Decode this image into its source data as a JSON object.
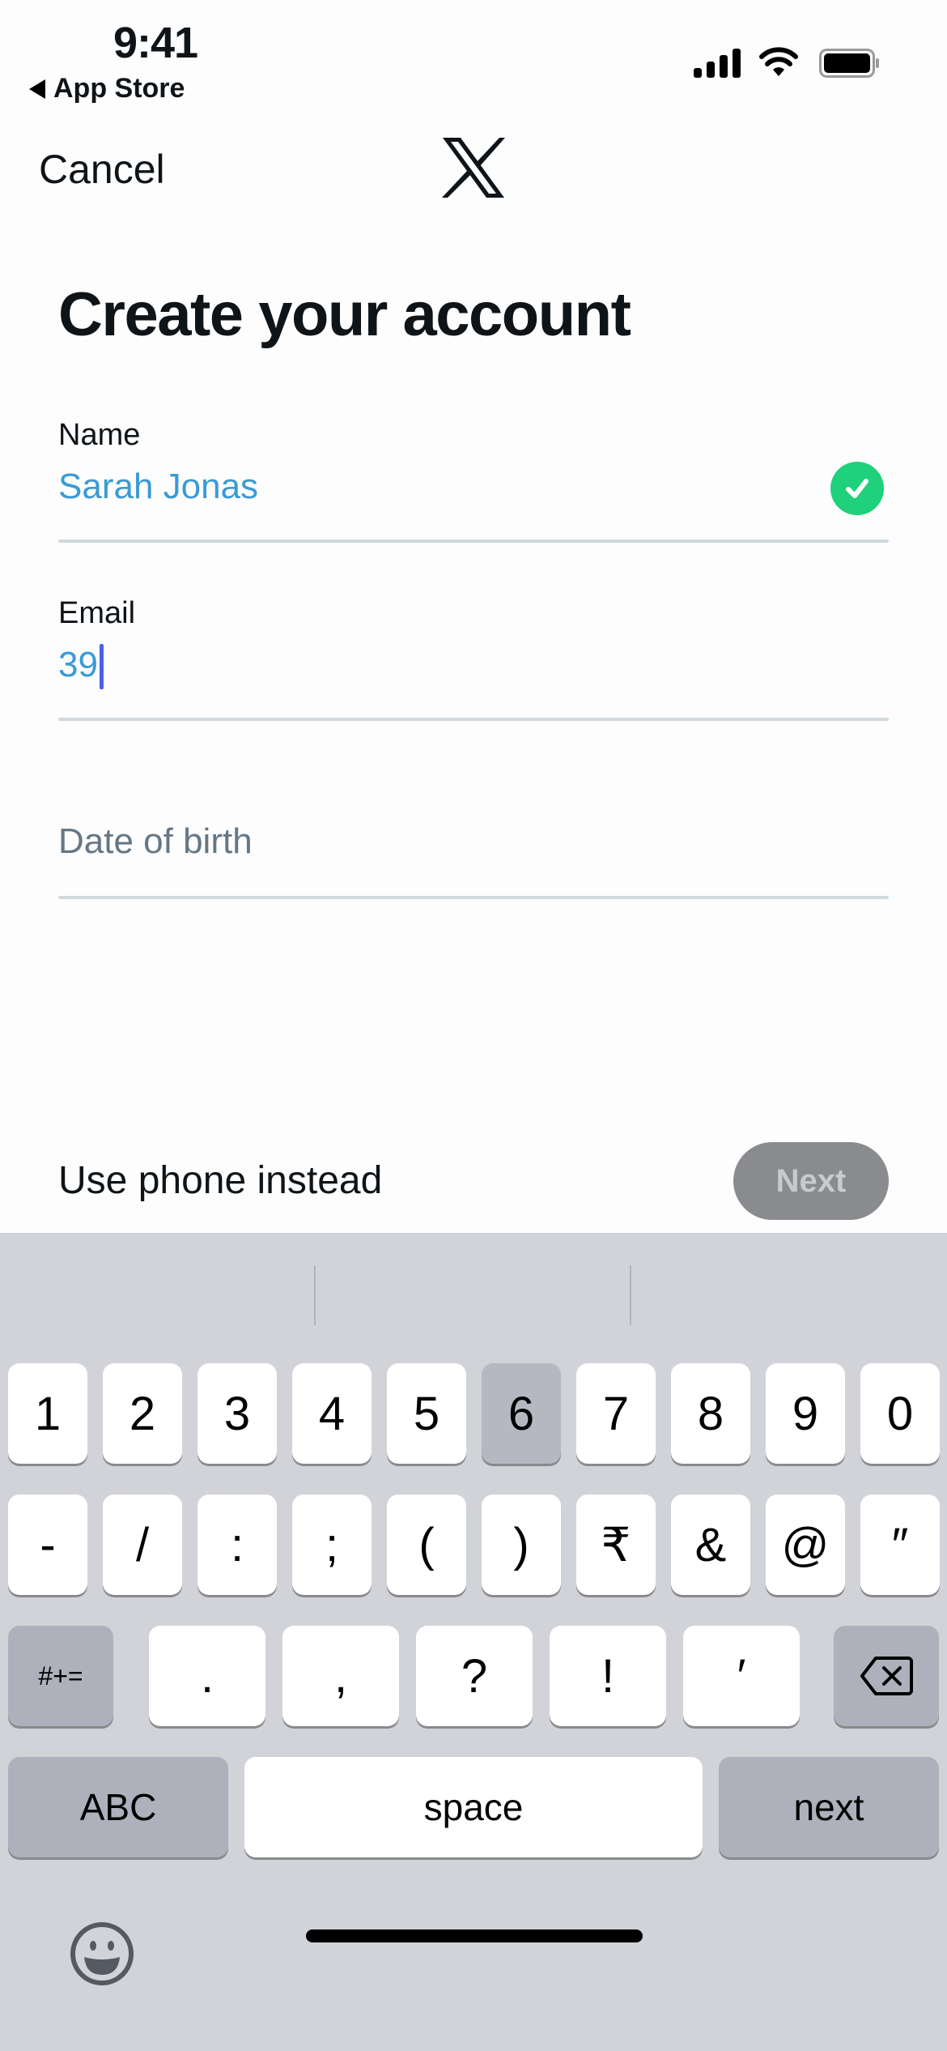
{
  "status_bar": {
    "time": "9:41",
    "back_label": "App Store",
    "signal_icon": "cellular-signal-icon",
    "wifi_icon": "wifi-icon",
    "battery_icon": "battery-icon"
  },
  "nav": {
    "cancel_label": "Cancel",
    "logo_icon": "x-logo-icon"
  },
  "page": {
    "title": "Create your account"
  },
  "form": {
    "name": {
      "label": "Name",
      "value": "Sarah Jonas",
      "valid": true
    },
    "email": {
      "label": "Email",
      "value": "39"
    },
    "dob": {
      "placeholder": "Date of birth"
    }
  },
  "footer": {
    "use_phone_label": "Use phone instead",
    "next_label": "Next",
    "next_enabled": false
  },
  "keyboard": {
    "row1": [
      "1",
      "2",
      "3",
      "4",
      "5",
      "6",
      "7",
      "8",
      "9",
      "0"
    ],
    "row1_pressed": "6",
    "row2": [
      "-",
      "/",
      ":",
      ";",
      "(",
      ")",
      "₹",
      "&",
      "@",
      "″"
    ],
    "row3_mode": "#+=",
    "row3": [
      ".",
      ",",
      "?",
      "!",
      "′"
    ],
    "delete_icon": "backspace-icon",
    "abc_label": "ABC",
    "space_label": "space",
    "return_label": "next",
    "emoji_icon": "emoji-icon"
  },
  "colors": {
    "accent_value": "#3a9bd5",
    "valid_green": "#1fd17a",
    "caret": "#4a60e8",
    "next_disabled_bg": "#8a8b8e"
  }
}
